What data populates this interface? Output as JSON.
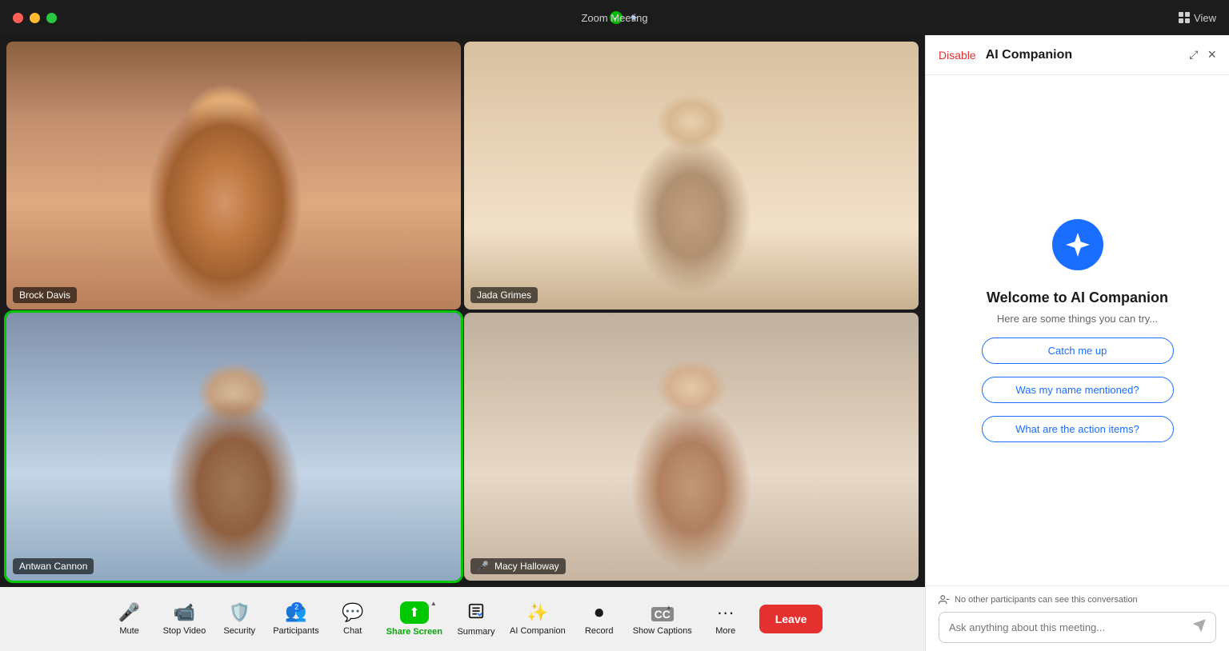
{
  "titlebar": {
    "title": "Zoom Meeting",
    "view_label": "View",
    "traffic_lights": [
      "red",
      "yellow",
      "green"
    ]
  },
  "participants": [
    {
      "name": "Brock Davis",
      "position": "top-left",
      "active": false,
      "muted": false
    },
    {
      "name": "Jada Grimes",
      "position": "top-right",
      "active": false,
      "muted": false
    },
    {
      "name": "Antwan Cannon",
      "position": "bottom-left",
      "active": true,
      "muted": false
    },
    {
      "name": "Macy Halloway",
      "position": "bottom-right",
      "active": false,
      "muted": true
    }
  ],
  "toolbar": {
    "items": [
      {
        "id": "mute",
        "icon": "🎤",
        "label": "Mute",
        "has_chevron": true
      },
      {
        "id": "stop-video",
        "icon": "📷",
        "label": "Stop Video",
        "has_chevron": true
      },
      {
        "id": "security",
        "icon": "🛡️",
        "label": "Security",
        "has_chevron": false
      },
      {
        "id": "participants",
        "icon": "👥",
        "label": "Participants",
        "has_chevron": true,
        "badge": "2"
      },
      {
        "id": "chat",
        "icon": "💬",
        "label": "Chat",
        "has_chevron": false
      },
      {
        "id": "share-screen",
        "icon": "⬆",
        "label": "Share Screen",
        "has_chevron": true,
        "special": true
      },
      {
        "id": "summary",
        "icon": "📋",
        "label": "Summary",
        "has_chevron": false
      },
      {
        "id": "ai-companion",
        "icon": "✨",
        "label": "AI Companion",
        "has_chevron": false
      },
      {
        "id": "record",
        "icon": "⭕",
        "label": "Record",
        "has_chevron": false
      },
      {
        "id": "show-captions",
        "icon": "CC",
        "label": "Show Captions",
        "has_chevron": true
      },
      {
        "id": "more",
        "icon": "•••",
        "label": "More",
        "has_chevron": false
      }
    ],
    "leave_label": "Leave"
  },
  "ai_panel": {
    "disable_label": "Disable",
    "title": "AI Companion",
    "welcome_title": "Welcome to AI Companion",
    "welcome_subtitle": "Here are some things you can try...",
    "suggestions": [
      "Catch me up",
      "Was my name mentioned?",
      "What are the action items?"
    ],
    "privacy_note": "No other participants can see this conversation",
    "input_placeholder": "Ask anything about this meeting..."
  }
}
